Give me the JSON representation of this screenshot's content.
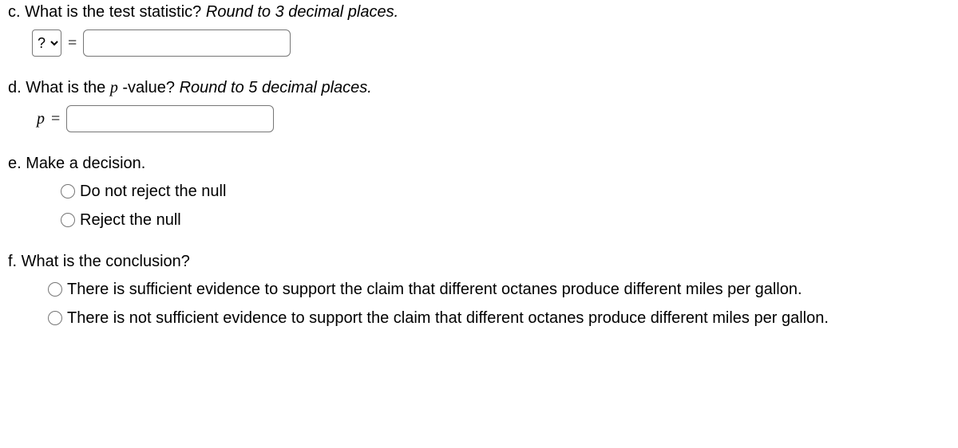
{
  "c": {
    "prompt_lead": "c. What is the test statistic? ",
    "prompt_italic": "Round to 3 decimal places.",
    "select_placeholder": "?",
    "equals": "="
  },
  "d": {
    "prompt_lead": "d. What is the ",
    "prompt_var": "p",
    "prompt_mid": " -value? ",
    "prompt_italic": "Round to 5 decimal places.",
    "var": "p",
    "equals": "="
  },
  "e": {
    "prompt": "e. Make a decision.",
    "options": [
      "Do not reject the null",
      "Reject the null"
    ]
  },
  "f": {
    "prompt": "f. What is the conclusion?",
    "options": [
      "There is sufficient evidence to support the claim that different octanes produce different miles per gallon.",
      "There is not sufficient evidence to support the claim that different octanes produce different miles per gallon."
    ]
  }
}
